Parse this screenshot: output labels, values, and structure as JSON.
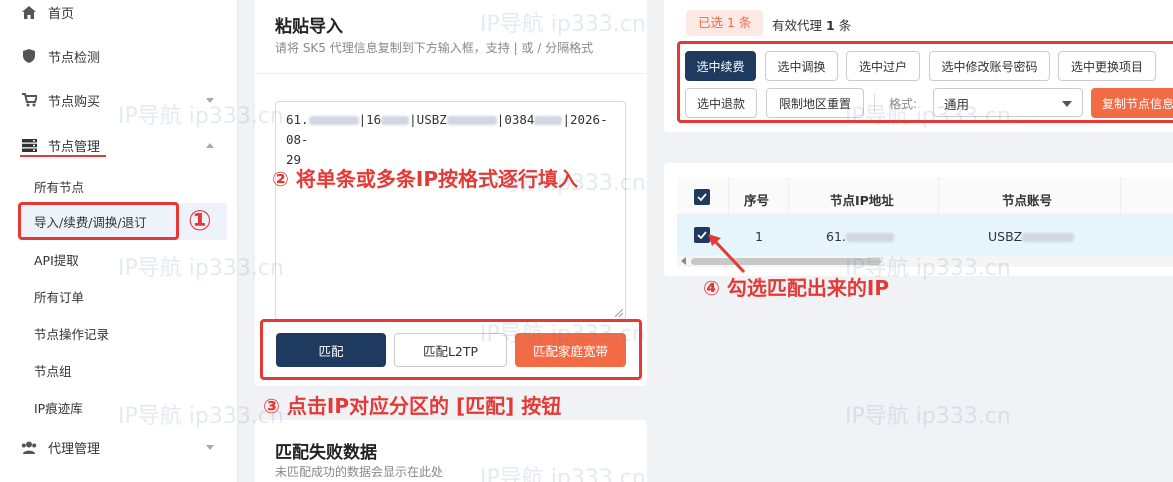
{
  "sidebar": {
    "items": [
      {
        "label": "首页"
      },
      {
        "label": "节点检测"
      },
      {
        "label": "节点购买"
      },
      {
        "label": "节点管理"
      },
      {
        "label": "代理管理"
      }
    ],
    "sub_items": [
      {
        "label": "所有节点"
      },
      {
        "label": "导入/续费/调换/退订"
      },
      {
        "label": "API提取"
      },
      {
        "label": "所有订单"
      },
      {
        "label": "节点操作记录"
      },
      {
        "label": "节点组"
      },
      {
        "label": "IP痕迹库"
      }
    ]
  },
  "paste_card": {
    "title": "粘贴导入",
    "subtitle": "请将 SK5 代理信息复制到下方输入框，支持 | 或 / 分隔格式",
    "textarea": {
      "p1": "61.",
      "p2": "|16",
      "p3": "|USBZ",
      "p4": "|0384",
      "p5": "|2026-08-",
      "p6": "29"
    },
    "buttons": {
      "match": "匹配",
      "match_l2tp": "匹配L2TP",
      "match_home": "匹配家庭宽带"
    }
  },
  "fail_card": {
    "title": "匹配失败数据",
    "subtitle": "未匹配成功的数据会显示在此处"
  },
  "selection": {
    "selected_label": "已选 1 条",
    "valid_prefix": "有效代理",
    "valid_count": "1",
    "valid_suffix": "条"
  },
  "actions": {
    "renew": "选中续费",
    "swap": "选中调换",
    "transfer": "选中过户",
    "change_password": "选中修改账号密码",
    "change_project": "选中更换项目",
    "refund": "选中退款",
    "reset_region": "限制地区重置",
    "format_label": "格式:",
    "format_value": "通用",
    "copy_info": "复制节点信息"
  },
  "table": {
    "headers": {
      "index": "序号",
      "ip": "节点IP地址",
      "account": "节点账号"
    },
    "rows": [
      {
        "index": "1",
        "ip": "61.",
        "account": "USBZ"
      }
    ]
  },
  "annotations": {
    "step1": "①",
    "step2": "② 将单条或多条IP按格式逐行填入",
    "step3": "③ 点击IP对应分区的 [匹配] 按钮",
    "step4": "④ 勾选匹配出来的IP"
  },
  "watermark": "IP导航  ip333.cn",
  "colors": {
    "accent_dark": "#1e3a5f",
    "accent_orange": "#f26b45",
    "annotation_red": "#e53935"
  }
}
